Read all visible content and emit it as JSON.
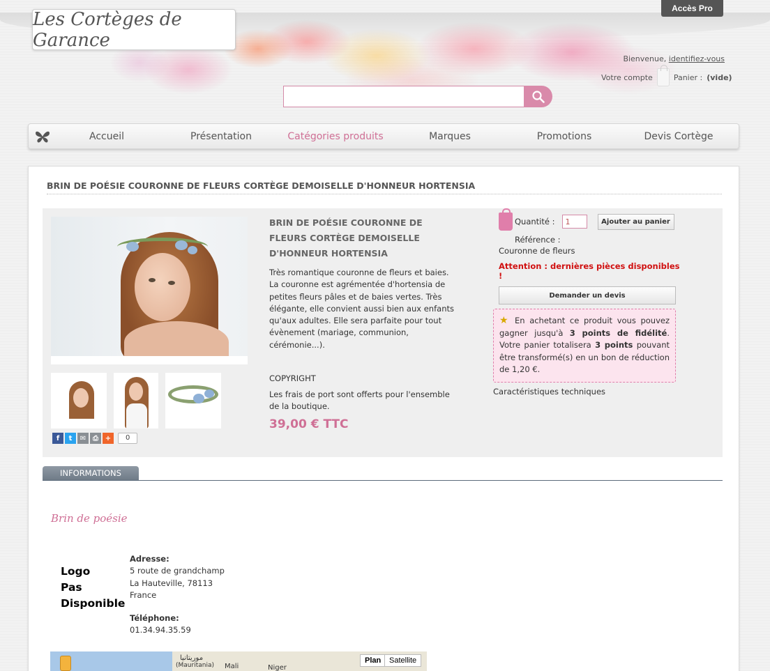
{
  "header": {
    "logo_text": "Les Cortèges de Garance",
    "acces_pro": "Accès Pro",
    "welcome": "Bienvenue,",
    "login_link": "identifiez-vous",
    "account": "Votre compte",
    "cart_label": "Panier :",
    "cart_status": "(vide)",
    "search_placeholder": ""
  },
  "nav": {
    "items": [
      {
        "label": "Accueil"
      },
      {
        "label": "Présentation"
      },
      {
        "label": "Catégories produits"
      },
      {
        "label": "Marques"
      },
      {
        "label": "Promotions"
      },
      {
        "label": "Devis Cortège"
      }
    ],
    "active_index": 2
  },
  "product": {
    "page_title": "BRIN DE POÉSIE COURONNE DE FLEURS CORTÈGE DEMOISELLE D'HONNEUR HORTENSIA",
    "title": "BRIN DE POÉSIE COURONNE DE FLEURS CORTÈGE DEMOISELLE D'HONNEUR HORTENSIA",
    "description": "Très romantique couronne de fleurs et baies. La couronne est agrémentée d'hortensia de petites fleurs pâles et de baies vertes. Très élégante, elle convient aussi bien aux enfants qu'aux adultes. Elle sera parfaite pour tout évènement (mariage, communion, cérémonie...).",
    "copyright": "COPYRIGHT",
    "shipping": " Les frais de port sont offerts pour l'ensemble de la boutique.",
    "price": "39,00 € TTC",
    "share_count": "0",
    "quantity_label": "Quantité :",
    "quantity_value": "1",
    "add_to_cart": "Ajouter au panier",
    "reference_label": "Référence :",
    "reference_value": "Couronne de fleurs",
    "warning": "Attention : dernières pièces disponibles !",
    "quote_button": "Demander un devis",
    "loyalty": {
      "part1": "En achetant ce produit vous pouvez gagner jusqu'à ",
      "points1": "3 points de fidélité",
      "part2": ". Votre panier totalisera ",
      "points2": "3 points",
      "part3": " pouvant être transformé(s) en un bon de réduction de 1,20 €."
    },
    "tech_specs": "Caractéristiques techniques"
  },
  "tabs": {
    "informations": "INFORMATIONS"
  },
  "brand": {
    "name": "Brin de poésie",
    "logo_na_1": "Logo",
    "logo_na_2": "Pas",
    "logo_na_3": "Disponible",
    "address_label": "Adresse:",
    "address_1": "5 route de grandchamp",
    "address_2": "La Hauteville, 78113",
    "address_3": "France",
    "phone_label": "Téléphone:",
    "phone": "01.34.94.35.59"
  },
  "map": {
    "label_mauritania_ar": "موريتانيا",
    "label_mauritania": "(Mauritania)",
    "label_mali": "Mali",
    "label_niger": "Niger",
    "plan": "Plan",
    "satellite": "Satellite"
  },
  "colors": {
    "accent": "#cf6f95",
    "warning": "#d01010"
  }
}
